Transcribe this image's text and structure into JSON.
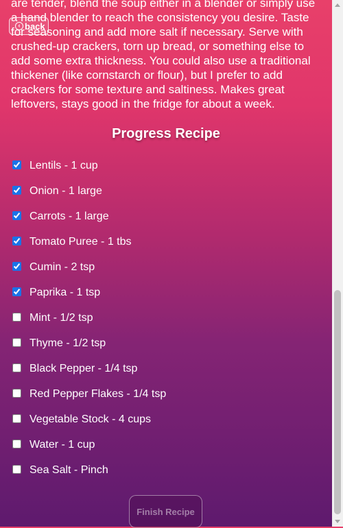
{
  "recipe": {
    "instructions_tail": "are tender, blend the soup either in a blender or simply use a hand blender to reach the consistency you desire. Taste for seasoning and add more salt if necessary. Serve with crushed-up crackers, torn up bread, or something else to add some extra thickness. You could also use a traditional thickener (like cornstarch or flour), but I prefer to add crackers for some texture and saltiness. Makes great leftovers, stays good in the fridge for about a week."
  },
  "nav": {
    "back_label": "back",
    "back_icon": "back-circle-icon"
  },
  "progress": {
    "title": "Progress Recipe",
    "ingredients": [
      {
        "label": "Lentils - 1 cup",
        "checked": true
      },
      {
        "label": "Onion - 1 large",
        "checked": true
      },
      {
        "label": "Carrots - 1 large",
        "checked": true
      },
      {
        "label": "Tomato Puree - 1 tbs",
        "checked": true
      },
      {
        "label": "Cumin - 2 tsp",
        "checked": true
      },
      {
        "label": "Paprika - 1 tsp",
        "checked": true
      },
      {
        "label": "Mint - 1/2 tsp",
        "checked": false
      },
      {
        "label": "Thyme - 1/2 tsp",
        "checked": false
      },
      {
        "label": "Black Pepper - 1/4 tsp",
        "checked": false
      },
      {
        "label": "Red Pepper Flakes - 1/4 tsp",
        "checked": false
      },
      {
        "label": "Vegetable Stock - 4 cups",
        "checked": false
      },
      {
        "label": "Water - 1 cup",
        "checked": false
      },
      {
        "label": "Sea Salt - Pinch",
        "checked": false
      }
    ],
    "finish_label": "Finish Recipe",
    "finish_disabled": true
  },
  "colors": {
    "gradient_top": "#e8406a",
    "gradient_bottom": "#5e1a6e",
    "checkbox_accent": "#1a73e8"
  }
}
